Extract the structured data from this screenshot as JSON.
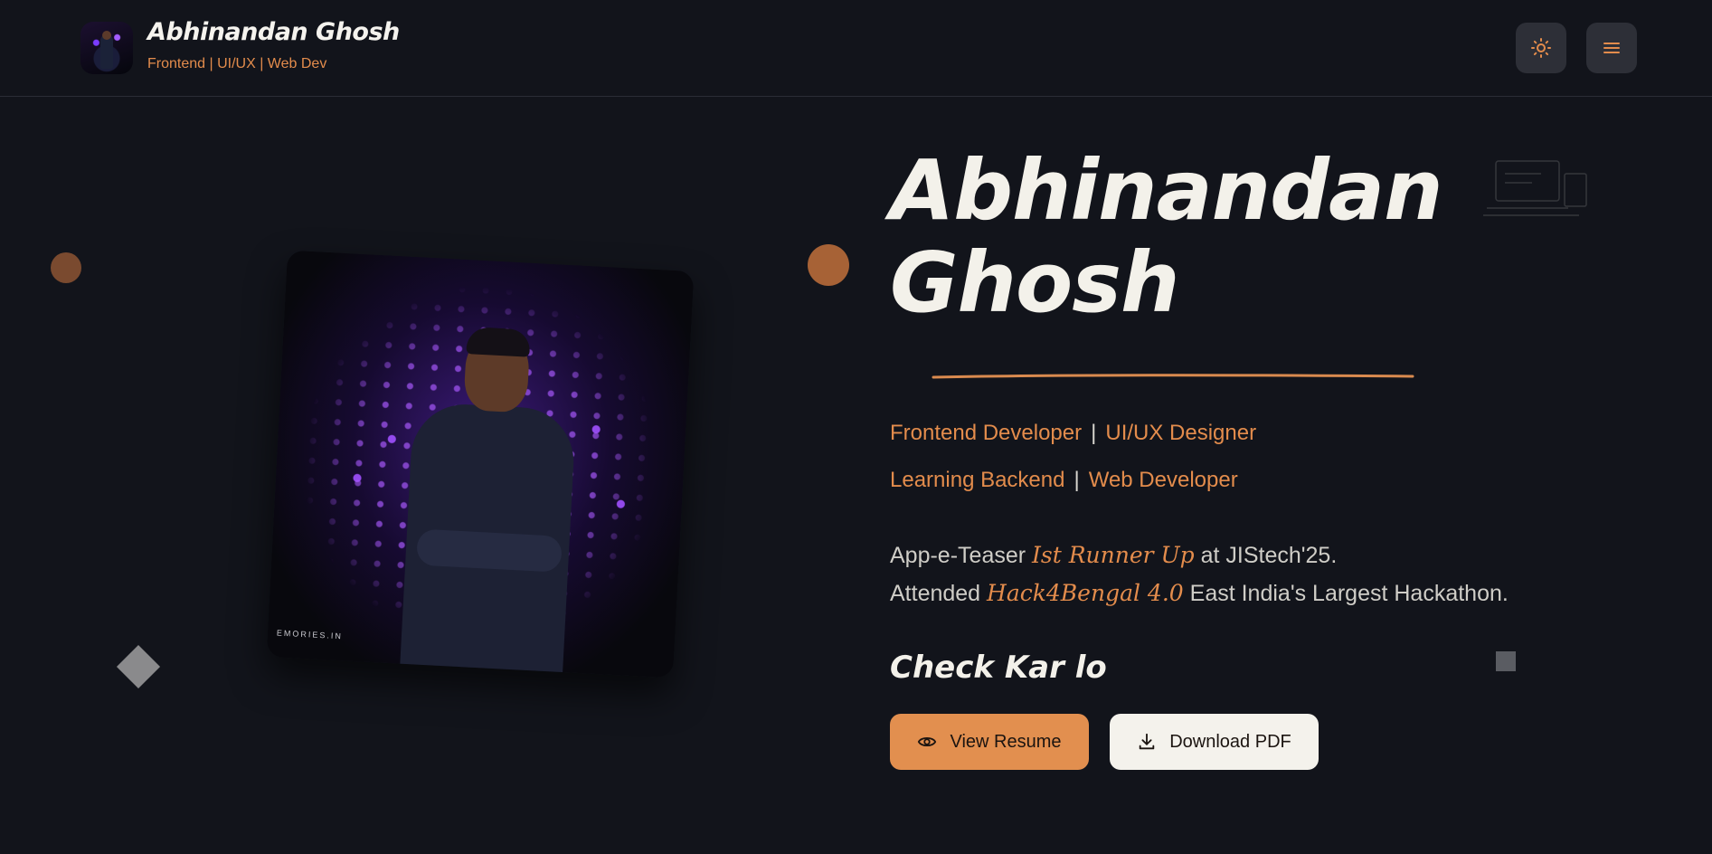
{
  "header": {
    "brand_name": "Abhinandan Ghosh",
    "tagline": "Frontend | UI/UX | Web Dev",
    "theme_icon": "sun-icon",
    "menu_icon": "hamburger-menu-icon"
  },
  "hero": {
    "title_line1": "Abhinandan",
    "title_line2": "Ghosh",
    "roles": [
      [
        "Frontend Developer",
        "UI/UX Designer"
      ],
      [
        "Learning Backend",
        "Web Developer"
      ]
    ],
    "separator": "|",
    "achievements": [
      {
        "before": "App-e-Teaser",
        "highlight": "Ist Runner Up",
        "after": "at JIStech'25."
      },
      {
        "before": "Attended",
        "highlight": "Hack4Bengal 4.0",
        "after": "East India's Largest Hackathon."
      }
    ],
    "cta_heading": "Check Kar lo",
    "view_resume_label": "View Resume",
    "download_pdf_label": "Download PDF"
  },
  "photo": {
    "watermark": "EMORIES.IN"
  },
  "colors": {
    "background": "#12141b",
    "accent": "#e38c4c",
    "button_light": "#f4f2ec"
  }
}
